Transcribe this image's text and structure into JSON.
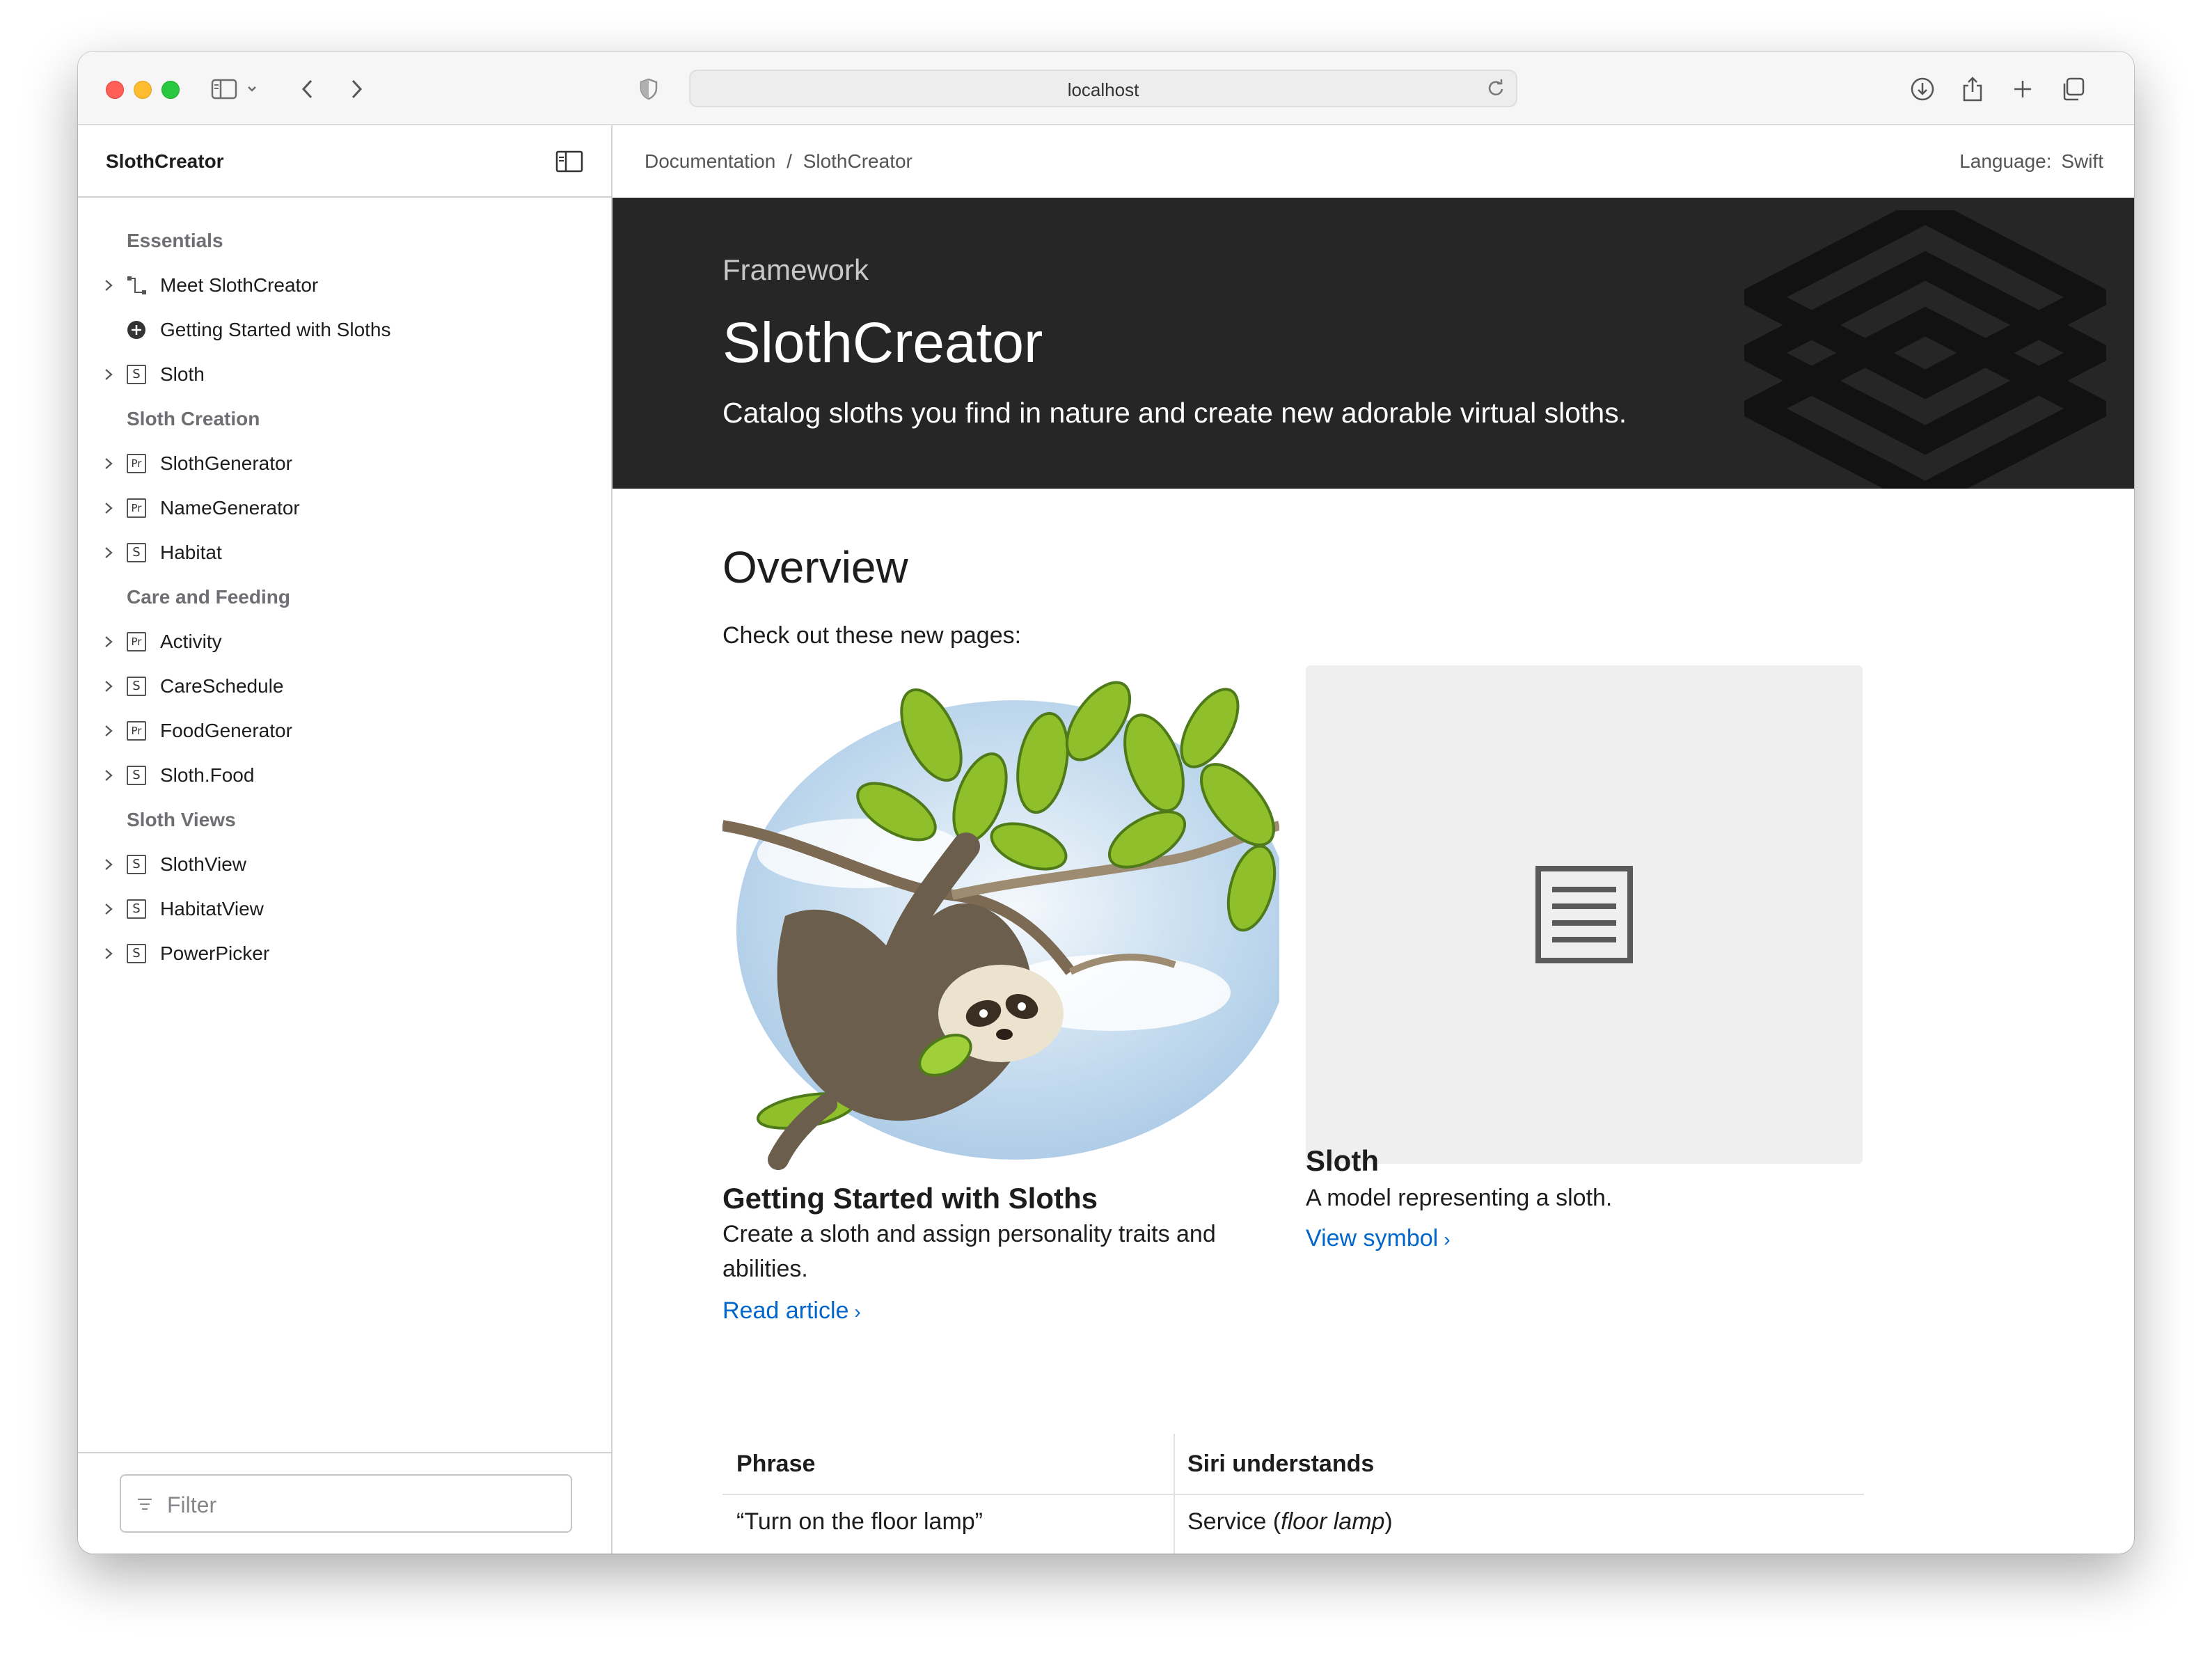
{
  "browser": {
    "url": "localhost"
  },
  "sidebar": {
    "title": "SlothCreator",
    "filter_placeholder": "Filter",
    "groups": [
      {
        "heading": "Essentials",
        "items": [
          {
            "label": "Meet SlothCreator",
            "icon": "tutorial-icon",
            "expandable": true
          },
          {
            "label": "Getting Started with Sloths",
            "icon": "article-icon",
            "expandable": false
          },
          {
            "label": "Sloth",
            "icon": "struct-icon",
            "expandable": true
          }
        ]
      },
      {
        "heading": "Sloth Creation",
        "items": [
          {
            "label": "SlothGenerator",
            "icon": "protocol-icon",
            "expandable": true
          },
          {
            "label": "NameGenerator",
            "icon": "protocol-icon",
            "expandable": true
          },
          {
            "label": "Habitat",
            "icon": "struct-icon",
            "expandable": true
          }
        ]
      },
      {
        "heading": "Care and Feeding",
        "items": [
          {
            "label": "Activity",
            "icon": "protocol-icon",
            "expandable": true
          },
          {
            "label": "CareSchedule",
            "icon": "struct-icon",
            "expandable": true
          },
          {
            "label": "FoodGenerator",
            "icon": "protocol-icon",
            "expandable": true
          },
          {
            "label": "Sloth.Food",
            "icon": "struct-icon",
            "expandable": true
          }
        ]
      },
      {
        "heading": "Sloth Views",
        "items": [
          {
            "label": "SlothView",
            "icon": "struct-icon",
            "expandable": true
          },
          {
            "label": "HabitatView",
            "icon": "struct-icon",
            "expandable": true
          },
          {
            "label": "PowerPicker",
            "icon": "struct-icon",
            "expandable": true
          }
        ]
      }
    ]
  },
  "breadcrumb": {
    "items": [
      "Documentation",
      "SlothCreator"
    ],
    "separator": "/"
  },
  "language": {
    "label": "Language:",
    "value": "Swift"
  },
  "hero": {
    "eyebrow": "Framework",
    "title": "SlothCreator",
    "abstract": "Catalog sloths you find in nature and create new adorable virtual sloths."
  },
  "overview": {
    "heading": "Overview",
    "intro": "Check out these new pages:",
    "cards": [
      {
        "title": "Getting Started with Sloths",
        "abstract": "Create a sloth and assign personality traits and abilities.",
        "link": "Read article",
        "image": "sloth-illustration"
      },
      {
        "title": "Sloth",
        "abstract": "A model representing a sloth.",
        "link": "View symbol",
        "image": "document-icon"
      }
    ]
  },
  "table": {
    "headers": [
      "Phrase",
      "Siri understands"
    ],
    "rows": [
      {
        "phrase": "“Turn on the floor lamp”",
        "understands_prefix": "Service (",
        "understands_em": "floor lamp",
        "understands_suffix": ")"
      }
    ]
  },
  "colors": {
    "hero_bg": "#262626",
    "link": "#0066cc",
    "placeholder_bg": "#efefef"
  }
}
